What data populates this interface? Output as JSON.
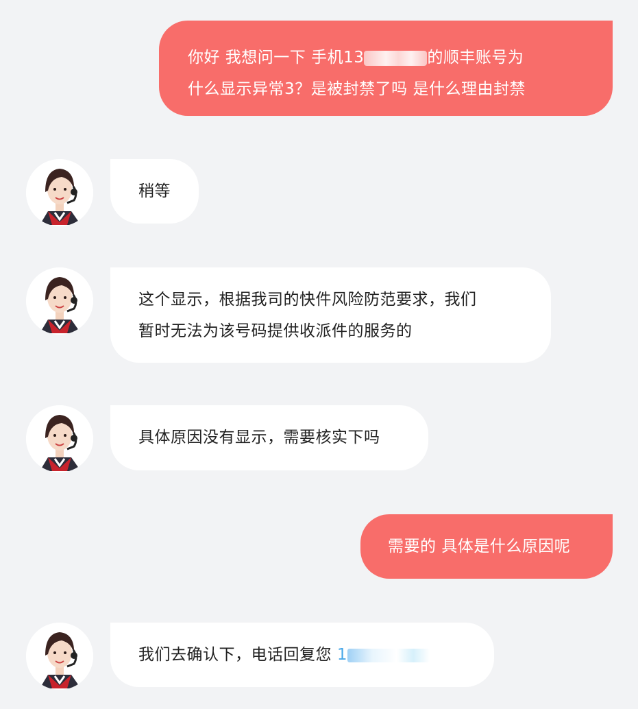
{
  "messages": [
    {
      "side": "out",
      "line1_pre": "你好 我想问一下 手机13",
      "line1_post": "的顺丰账号为",
      "line2": "什么显示异常3？是被封禁了吗 是什么理由封禁"
    },
    {
      "side": "in",
      "text": "稍等"
    },
    {
      "side": "in",
      "line1": "这个显示，根据我司的快件风险防范要求，我们",
      "line2": "暂时无法为该号码提供收派件的服务的"
    },
    {
      "side": "in",
      "text": "具体原因没有显示，需要核实下吗"
    },
    {
      "side": "out",
      "text": "需要的 具体是什么原因呢"
    },
    {
      "side": "in",
      "text": "我们去确认下，电话回复您",
      "phone_prefix": "1"
    }
  ],
  "colors": {
    "outgoing": "#f86d6a",
    "incoming": "#ffffff",
    "background": "#f2f3f5",
    "link": "#4aa8e8"
  },
  "icons": {
    "avatar": "agent-avatar-icon"
  }
}
